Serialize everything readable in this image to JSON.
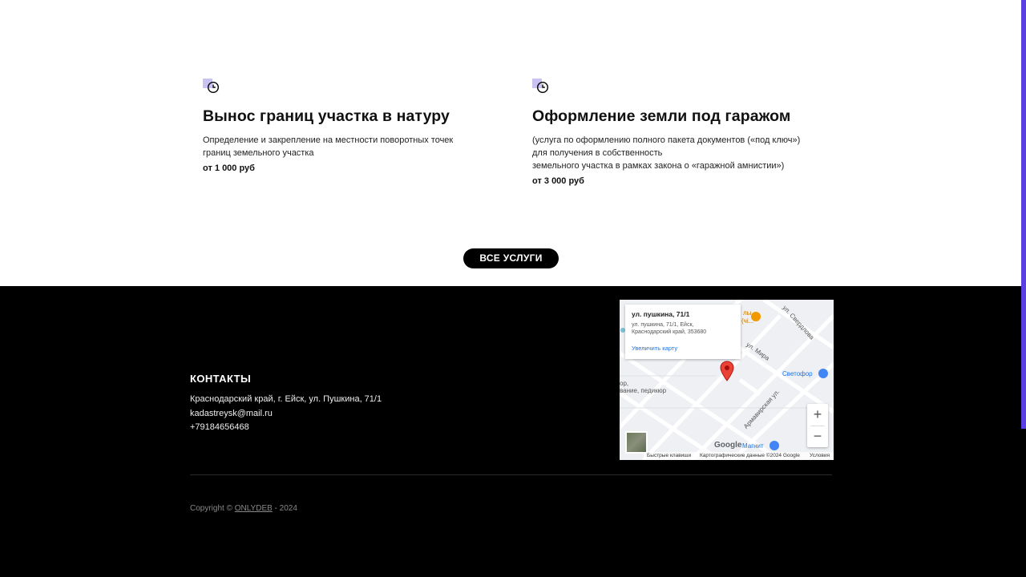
{
  "services": [
    {
      "title": "Вынос границ участка в натуру",
      "desc_lines": [
        "Определение и закрепление на местности поворотных точек",
        "границ земельного участка"
      ],
      "price": "от 1 000 руб",
      "icon": "clock-icon"
    },
    {
      "title": "Оформление земли под гаражом",
      "desc_lines": [
        "(услуга по оформлению полного пакета документов («под ключ»)",
        "для получения в собственность",
        "земельного участка в рамках закона о «гаражной амнистии»)"
      ],
      "price": "от 3 000 руб",
      "icon": "clock-icon"
    }
  ],
  "all_services_label": "ВСЕ УСЛУГИ",
  "footer": {
    "contacts_title": "КОНТАКТЫ",
    "address": "Краснодарский край, г. Ейск, ул. Пушкина, 71/1",
    "email": "kadastreysk@mail.ru",
    "phone": "+79184656468",
    "copyright_prefix": "Copyright ©",
    "copyright_link": "ONLYDEB",
    "copyright_suffix": "- 2024"
  },
  "map": {
    "info_title": "ул. пушкина, 71/1",
    "info_addr1": "ул. пушкина, 71/1, Ейск,",
    "info_addr2": "Краснодарский край, 353680",
    "info_link": "Увеличить карту",
    "labels": {
      "street_sverdlova": "ул. Свердлова",
      "street_mira": "ул. Мира",
      "street_armavirskaya": "Армавирская ул.",
      "svetofor": "Светофор",
      "magnit": "Магнит",
      "pedicure": "вание, педикюр",
      "partial_left": "ор,",
      "partial_right_top": "лы",
      "partial_right_top2": "(чi..."
    },
    "google": "Google",
    "bar_shortcuts": "Быстрые клавиши",
    "bar_data": "Картографические данные ©2024 Google",
    "bar_terms": "Условия",
    "zoom_in": "+",
    "zoom_out": "−",
    "accent_pin": "#ea4335"
  }
}
